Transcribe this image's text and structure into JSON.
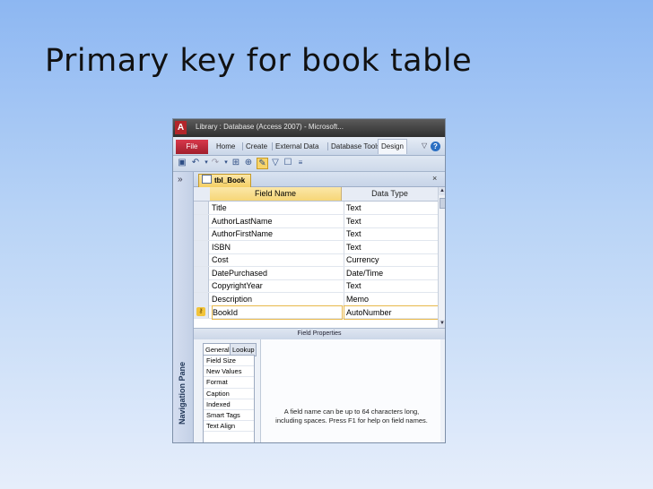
{
  "slide": {
    "title": "Primary key for book table"
  },
  "window": {
    "app_logo": "A",
    "title": "Library : Database (Access 2007) - Microsoft..."
  },
  "ribbon": {
    "file_tab": "File",
    "tabs": [
      "Home",
      "Create",
      "External Data",
      "Database Tools",
      "Design"
    ],
    "minimize_glyph": "▽",
    "help_glyph": "?"
  },
  "nav": {
    "toggle_glyph": "»",
    "label": "Navigation Pane"
  },
  "object_tab": {
    "label": "tbl_Book",
    "close_glyph": "×"
  },
  "grid": {
    "headers": {
      "field_name": "Field Name",
      "data_type": "Data Type"
    },
    "rows": [
      {
        "field": "Title",
        "type": "Text"
      },
      {
        "field": "AuthorLastName",
        "type": "Text"
      },
      {
        "field": "AuthorFirstName",
        "type": "Text"
      },
      {
        "field": "ISBN",
        "type": "Text"
      },
      {
        "field": "Cost",
        "type": "Currency"
      },
      {
        "field": "DatePurchased",
        "type": "Date/Time"
      },
      {
        "field": "CopyrightYear",
        "type": "Text"
      },
      {
        "field": "Description",
        "type": "Memo"
      },
      {
        "field": "BookId",
        "type": "AutoNumber"
      }
    ]
  },
  "field_properties": {
    "header": "Field Properties",
    "tabs": [
      "General",
      "Lookup"
    ],
    "props": [
      "Field Size",
      "New Values",
      "Format",
      "Caption",
      "Indexed",
      "Smart Tags",
      "Text Align"
    ],
    "help_text": "A field name can be up to 64 characters long, including spaces. Press F1 for help on field names."
  },
  "colors": {
    "accent": "#f5cf64",
    "file_tab": "#c62d3f",
    "title_bar": "#3b3b3b"
  }
}
